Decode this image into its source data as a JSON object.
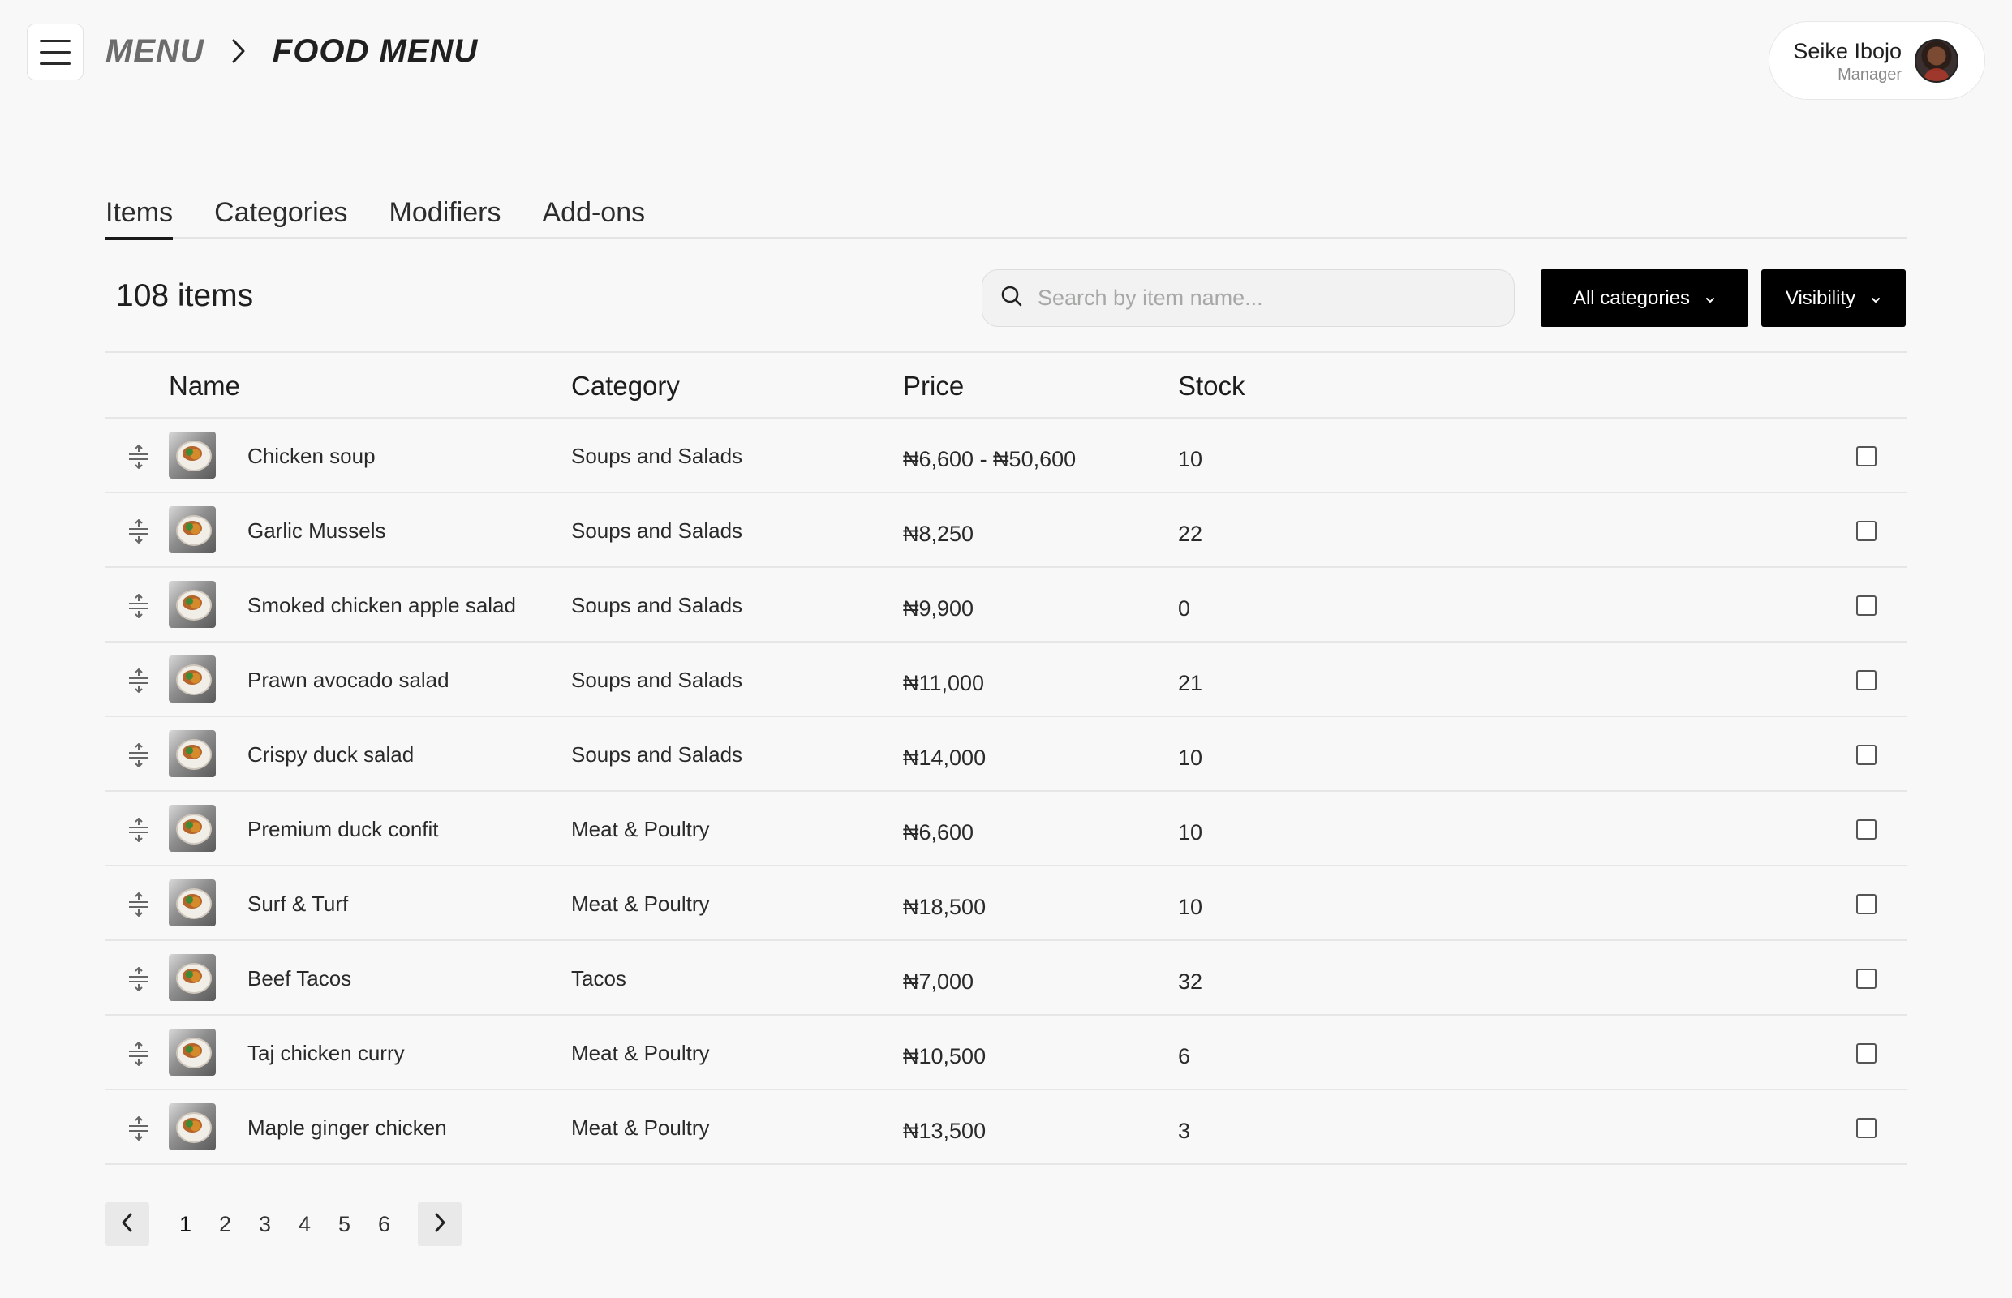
{
  "header": {
    "breadcrumb": {
      "root": "MENU",
      "current": "FOOD MENU"
    },
    "user": {
      "name": "Seike Ibojo",
      "role": "Manager"
    }
  },
  "tabs": [
    {
      "label": "Items",
      "active": true
    },
    {
      "label": "Categories",
      "active": false
    },
    {
      "label": "Modifiers",
      "active": false
    },
    {
      "label": "Add-ons",
      "active": false
    }
  ],
  "toolbar": {
    "count_label": "108 items",
    "search_placeholder": "Search by item name...",
    "category_filter": "All categories",
    "visibility_filter": "Visibility"
  },
  "table": {
    "columns": {
      "name": "Name",
      "category": "Category",
      "price": "Price",
      "stock": "Stock"
    },
    "rows": [
      {
        "name": "Chicken soup",
        "category": "Soups and Salads",
        "price": "₦6,600 -  ₦50,600",
        "stock": "10"
      },
      {
        "name": "Garlic Mussels",
        "category": "Soups and Salads",
        "price": "₦8,250",
        "stock": "22"
      },
      {
        "name": "Smoked chicken apple salad",
        "category": "Soups and Salads",
        "price": "₦9,900",
        "stock": "0"
      },
      {
        "name": "Prawn avocado salad",
        "category": "Soups and Salads",
        "price": "₦11,000",
        "stock": "21"
      },
      {
        "name": "Crispy duck salad",
        "category": "Soups and Salads",
        "price": "₦14,000",
        "stock": "10"
      },
      {
        "name": "Premium duck confit",
        "category": "Meat & Poultry",
        "price": "₦6,600",
        "stock": "10"
      },
      {
        "name": "Surf & Turf",
        "category": "Meat & Poultry",
        "price": "₦18,500",
        "stock": "10"
      },
      {
        "name": "Beef Tacos",
        "category": "Tacos",
        "price": "₦7,000",
        "stock": "32"
      },
      {
        "name": "Taj chicken curry",
        "category": "Meat & Poultry",
        "price": "₦10,500",
        "stock": "6"
      },
      {
        "name": "Maple ginger chicken",
        "category": "Meat & Poultry",
        "price": "₦13,500",
        "stock": "3"
      }
    ]
  },
  "pagination": {
    "pages": [
      "1",
      "2",
      "3",
      "4",
      "5",
      "6"
    ],
    "current": "1"
  }
}
